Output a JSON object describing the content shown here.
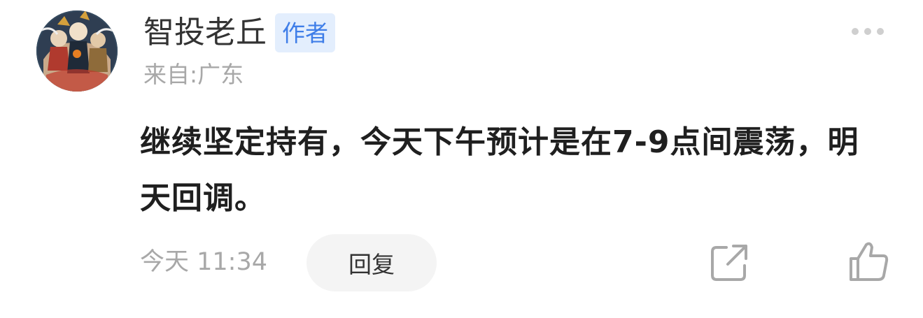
{
  "comment": {
    "author": {
      "name": "智投老丘",
      "badge": "作者",
      "avatar_icon": "illustrated-figures-avatar"
    },
    "location": "来自:广东",
    "text": "继续坚定持有，今天下午预计是在7-9点间震荡，明天回调。",
    "timestamp": "今天 11:34",
    "actions": {
      "reply_label": "回复",
      "share_icon": "share-external-icon",
      "like_icon": "thumbs-up-icon",
      "more_icon": "more-dots-icon"
    }
  },
  "colors": {
    "badge_bg": "#e3eefd",
    "badge_text": "#3f7ee8",
    "muted_text": "#a8a8a8",
    "reply_bg": "#f4f4f4"
  }
}
